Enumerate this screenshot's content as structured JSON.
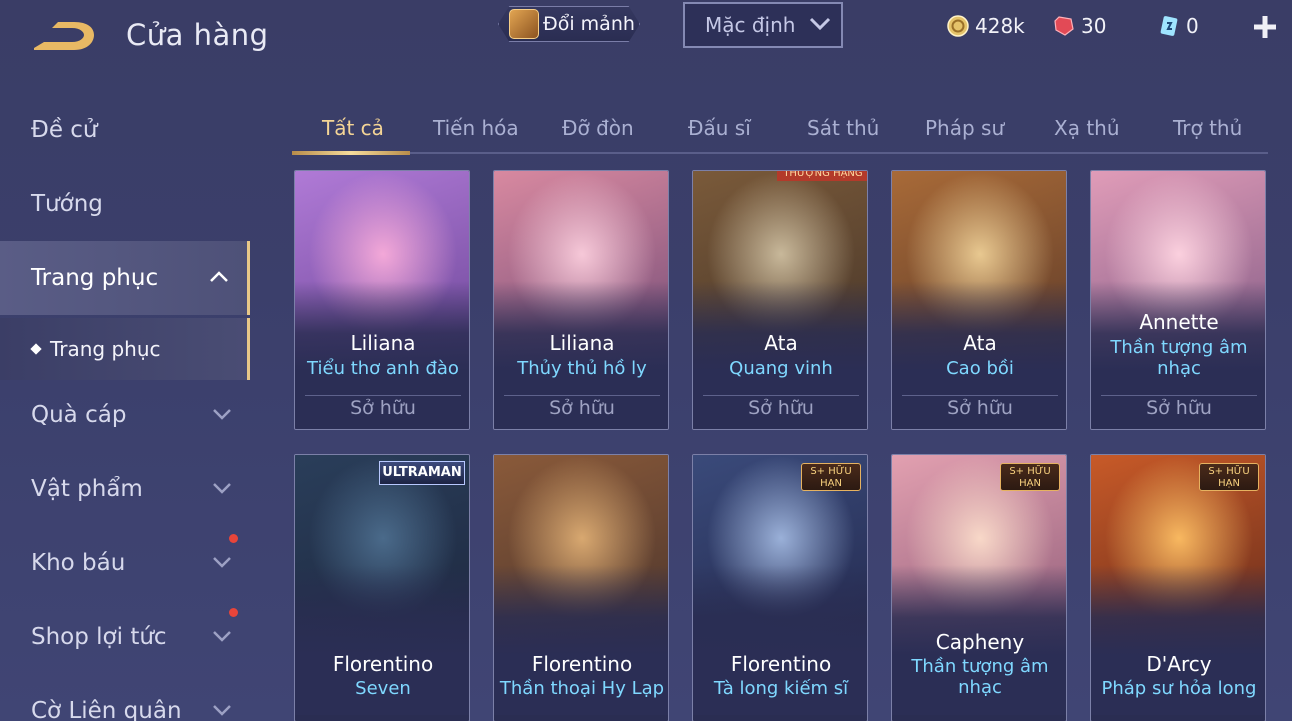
{
  "header": {
    "title": "Cửa hàng",
    "exchange_label": "Đổi mảnh",
    "sort_value": "Mặc định",
    "gold": "428k",
    "gems": "30",
    "vouchers": "0"
  },
  "sidebar": {
    "items": [
      {
        "label": "Đề cử"
      },
      {
        "label": "Tướng"
      },
      {
        "label": "Trang phục"
      },
      {
        "label": "Trang phục"
      },
      {
        "label": "Quà cáp"
      },
      {
        "label": "Vật phẩm"
      },
      {
        "label": "Kho báu"
      },
      {
        "label": "Shop lợi tức"
      },
      {
        "label": "Cờ Liên quân"
      }
    ]
  },
  "tabs": [
    "Tất cả",
    "Tiến hóa",
    "Đỡ đòn",
    "Đấu sĩ",
    "Sát thủ",
    "Pháp sư",
    "Xạ thủ",
    "Trợ thủ"
  ],
  "cards": [
    {
      "hero": "Liliana",
      "skin": "Tiểu thơ anh đào",
      "status": "Sở hữu",
      "colors": [
        "#f3a8d8",
        "#b07ad6",
        "#5c3a8a"
      ]
    },
    {
      "hero": "Liliana",
      "skin": "Thủy thủ hồ ly",
      "status": "Sở hữu",
      "colors": [
        "#f6c8d8",
        "#d889a0",
        "#5a3c6c"
      ]
    },
    {
      "hero": "Ata",
      "skin": "Quang vinh",
      "status": "Sở hữu",
      "badge": "THƯỢNG HẠNG",
      "colors": [
        "#c8b89a",
        "#7a5a3a",
        "#3a2c24"
      ]
    },
    {
      "hero": "Ata",
      "skin": "Cao bồi",
      "status": "Sở hữu",
      "colors": [
        "#e8c890",
        "#a86a38",
        "#4a2e24"
      ]
    },
    {
      "hero": "Annette",
      "skin": "Thần tượng âm nhạc",
      "status": "Sở hữu",
      "colors": [
        "#fbd0de",
        "#e09cb8",
        "#6a4a78"
      ]
    },
    {
      "hero": "Florentino",
      "skin": "Seven",
      "badge": "ULTRAMAN",
      "colors": [
        "#4a6a8a",
        "#2a3e5a",
        "#1a2238"
      ]
    },
    {
      "hero": "Florentino",
      "skin": "Thần thoại Hy Lạp",
      "colors": [
        "#d8a870",
        "#8a5a3a",
        "#3a2a28"
      ]
    },
    {
      "hero": "Florentino",
      "skin": "Tà long kiếm sĩ",
      "badge": "S+ HỮU HẠN",
      "colors": [
        "#9ab0d8",
        "#3a4a7a",
        "#1e2244"
      ]
    },
    {
      "hero": "Capheny",
      "skin": "Thần tượng âm nhạc",
      "badge": "S+ HỮU HẠN",
      "colors": [
        "#f8d8c8",
        "#e2a0b0",
        "#7a4a6a"
      ]
    },
    {
      "hero": "D'Arcy",
      "skin": "Pháp sư hỏa long",
      "badge": "S+ HỮU HẠN",
      "colors": [
        "#f8b860",
        "#c85a28",
        "#4a1e18"
      ]
    }
  ]
}
